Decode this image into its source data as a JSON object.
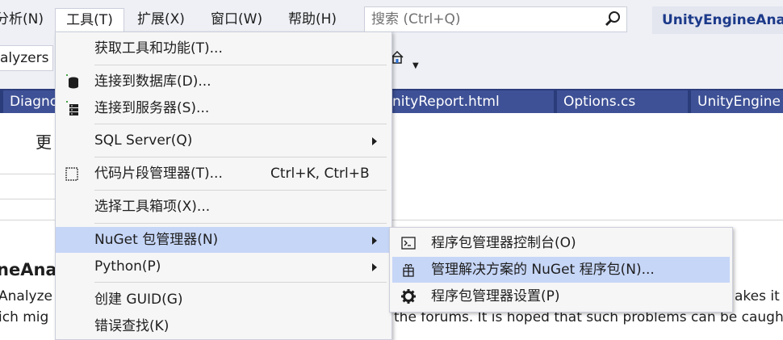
{
  "menubar": {
    "items": [
      "分析(N)",
      "工具(T)",
      "扩展(X)",
      "窗口(W)",
      "帮助(H)"
    ],
    "search_placeholder": "搜索 (Ctrl+Q)",
    "solution_name": "UnityEngineAnal"
  },
  "toolbar": {
    "combo_text": "alyzers"
  },
  "tabs": [
    "Diagno",
    "nityReport.html",
    "Options.cs",
    "UnityEngine"
  ],
  "content": {
    "heading_char": "更",
    "title_fragment": "neAna",
    "line1_left": "Analyze",
    "line1_right": "akes it e",
    "line2_left": "ich mig",
    "line2_right": "the forums. It is hoped that such problems can be caugh"
  },
  "tools_menu": {
    "items": [
      {
        "label": "获取工具和功能(T)...",
        "icon": ""
      },
      {
        "label": "连接到数据库(D)...",
        "icon": "database-icon"
      },
      {
        "label": "连接到服务器(S)...",
        "icon": "server-icon"
      },
      {
        "label": "SQL Server(Q)",
        "icon": "",
        "submenu": true
      },
      {
        "label": "代码片段管理器(T)...",
        "shortcut": "Ctrl+K, Ctrl+B",
        "icon": "snippet-icon"
      },
      {
        "label": "选择工具箱项(X)...",
        "icon": ""
      },
      {
        "label": "NuGet 包管理器(N)",
        "icon": "",
        "submenu": true,
        "highlighted": true
      },
      {
        "label": "Python(P)",
        "icon": "",
        "submenu": true
      },
      {
        "label": "创建 GUID(G)",
        "icon": ""
      },
      {
        "label": "错误查找(K)",
        "icon": ""
      }
    ]
  },
  "nuget_submenu": {
    "items": [
      {
        "label": "程序包管理器控制台(O)",
        "icon": "console-icon"
      },
      {
        "label": "管理解决方案的 NuGet 程序包(N)...",
        "icon": "package-icon",
        "highlighted": true
      },
      {
        "label": "程序包管理器设置(P)",
        "icon": "gear-icon"
      }
    ]
  },
  "colors": {
    "menu_bg": "#f6f6f6",
    "highlight": "#c6d6f7",
    "tab_bar": "#2b3c7a",
    "tab": "#3e5196",
    "solution_text": "#1c3a8a"
  }
}
